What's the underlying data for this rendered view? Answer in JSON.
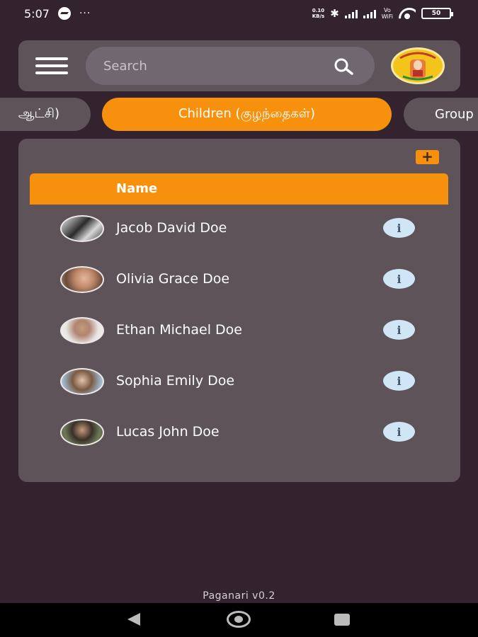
{
  "status_bar": {
    "time": "5:07",
    "more": "···",
    "speed_value": "0.10",
    "speed_unit": "KB/s",
    "vo_label": "Vo",
    "wifi_label": "WiFi",
    "battery": "50"
  },
  "app_bar": {
    "search_placeholder": "Search"
  },
  "tabs": [
    {
      "label": "ஆட்சி)"
    },
    {
      "label": "Children (குழந்தைகள்)"
    },
    {
      "label": "Group"
    }
  ],
  "table": {
    "add_label": "+",
    "column_name": "Name",
    "rows": [
      {
        "name": "Jacob David Doe",
        "info": "i"
      },
      {
        "name": "Olivia Grace Doe",
        "info": "i"
      },
      {
        "name": "Ethan Michael Doe",
        "info": "i"
      },
      {
        "name": "Sophia Emily Doe",
        "info": "i"
      },
      {
        "name": "Lucas John Doe",
        "info": "i"
      }
    ]
  },
  "footer": {
    "version": "Paganari v0.2"
  },
  "colors": {
    "background": "#32232f",
    "surface": "#5d5359",
    "accent": "#f7900c",
    "info": "#d0e6f6"
  },
  "icons": {
    "menu": "hamburger-icon",
    "search": "search-icon",
    "info": "info-icon",
    "add": "plus-icon",
    "back": "back-triangle-icon",
    "home": "home-circle-icon",
    "recent": "recent-square-icon"
  }
}
